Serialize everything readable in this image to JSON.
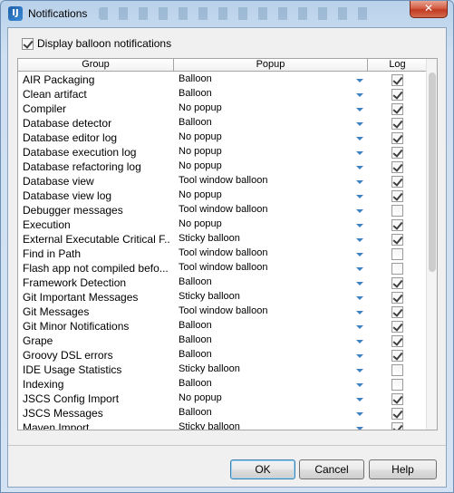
{
  "window": {
    "title": "Notifications",
    "icon_text": "IJ",
    "close_glyph": "✕"
  },
  "display_balloon": {
    "label": "Display balloon notifications",
    "checked": true
  },
  "table": {
    "columns": [
      "Group",
      "Popup",
      "Log"
    ],
    "rows": [
      {
        "group": "AIR Packaging",
        "popup": "Balloon",
        "log": true
      },
      {
        "group": "Clean artifact",
        "popup": "Balloon",
        "log": true
      },
      {
        "group": "Compiler",
        "popup": "No popup",
        "log": true
      },
      {
        "group": "Database detector",
        "popup": "Balloon",
        "log": true
      },
      {
        "group": "Database editor log",
        "popup": "No popup",
        "log": true
      },
      {
        "group": "Database execution log",
        "popup": "No popup",
        "log": true
      },
      {
        "group": "Database refactoring log",
        "popup": "No popup",
        "log": true
      },
      {
        "group": "Database view",
        "popup": "Tool window balloon",
        "log": true
      },
      {
        "group": "Database view log",
        "popup": "No popup",
        "log": true
      },
      {
        "group": "Debugger messages",
        "popup": "Tool window balloon",
        "log": false
      },
      {
        "group": "Execution",
        "popup": "No popup",
        "log": true
      },
      {
        "group": "External Executable Critical F...",
        "popup": "Sticky balloon",
        "log": true
      },
      {
        "group": "Find in Path",
        "popup": "Tool window balloon",
        "log": false
      },
      {
        "group": "Flash app not compiled befo...",
        "popup": "Tool window balloon",
        "log": false
      },
      {
        "group": "Framework Detection",
        "popup": "Balloon",
        "log": true
      },
      {
        "group": "Git Important Messages",
        "popup": "Sticky balloon",
        "log": true
      },
      {
        "group": "Git Messages",
        "popup": "Tool window balloon",
        "log": true
      },
      {
        "group": "Git Minor Notifications",
        "popup": "Balloon",
        "log": true
      },
      {
        "group": "Grape",
        "popup": "Balloon",
        "log": true
      },
      {
        "group": "Groovy DSL errors",
        "popup": "Balloon",
        "log": true
      },
      {
        "group": "IDE Usage Statistics",
        "popup": "Sticky balloon",
        "log": false
      },
      {
        "group": "Indexing",
        "popup": "Balloon",
        "log": false
      },
      {
        "group": "JSCS Config Import",
        "popup": "No popup",
        "log": true
      },
      {
        "group": "JSCS Messages",
        "popup": "Balloon",
        "log": true
      },
      {
        "group": "Maven Import",
        "popup": "Sticky balloon",
        "log": true
      }
    ]
  },
  "buttons": {
    "ok": "OK",
    "cancel": "Cancel",
    "help": "Help"
  }
}
